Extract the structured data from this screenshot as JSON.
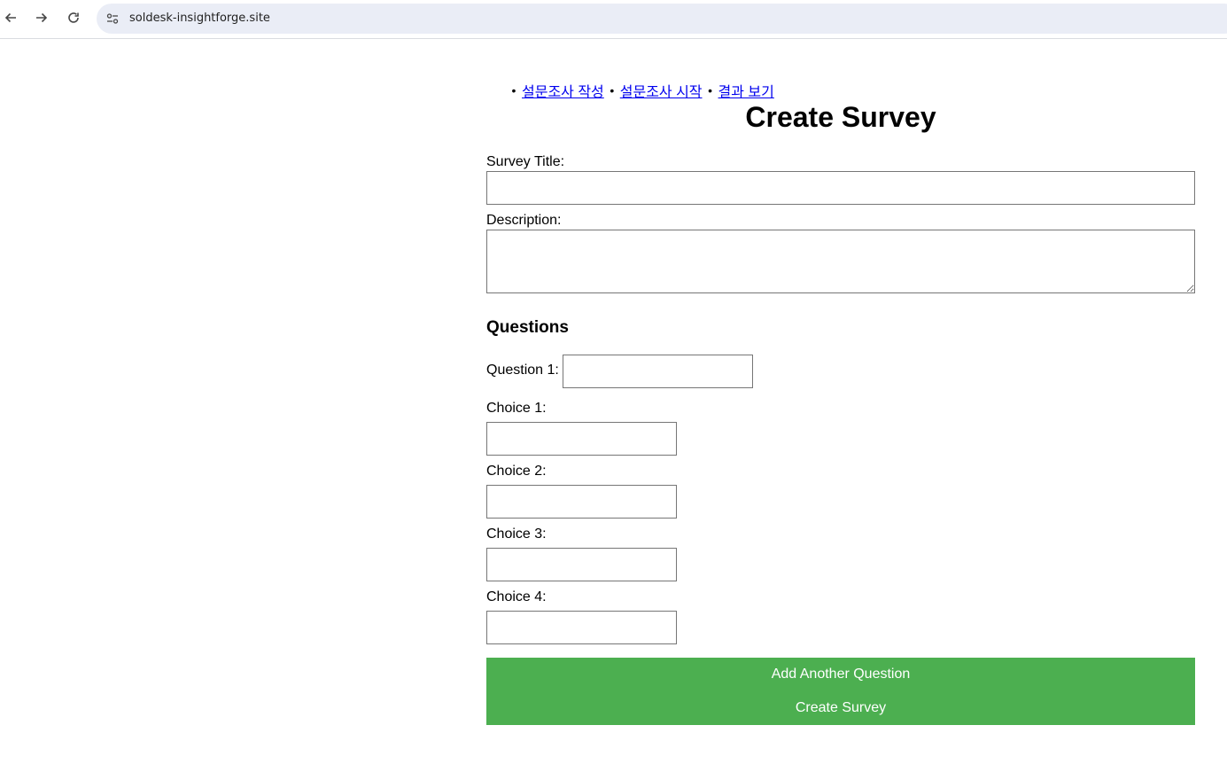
{
  "browser": {
    "url": "soldesk-insightforge.site"
  },
  "nav": {
    "items": [
      {
        "label": "설문조사 작성"
      },
      {
        "label": "설문조사 시작"
      },
      {
        "label": "결과 보기"
      }
    ]
  },
  "page": {
    "title": "Create Survey"
  },
  "form": {
    "survey_title_label": "Survey Title:",
    "survey_title_value": "",
    "description_label": "Description:",
    "description_value": "",
    "questions_heading": "Questions",
    "question_label": "Question 1:",
    "question_value": "",
    "choices": [
      {
        "label": "Choice 1:",
        "value": ""
      },
      {
        "label": "Choice 2:",
        "value": ""
      },
      {
        "label": "Choice 3:",
        "value": ""
      },
      {
        "label": "Choice 4:",
        "value": ""
      }
    ],
    "add_question_button": "Add Another Question",
    "create_survey_button": "Create Survey"
  },
  "colors": {
    "button_green": "#4caf50",
    "link_blue": "#0000ee",
    "omnibox_bg": "#eaedf6"
  }
}
